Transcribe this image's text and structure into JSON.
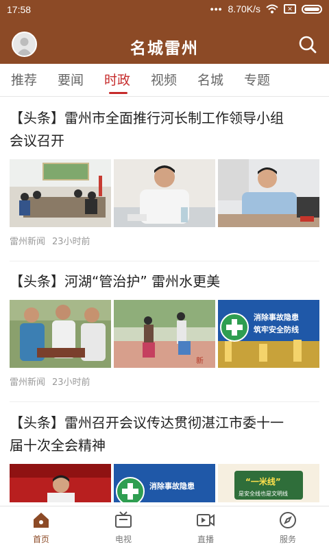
{
  "status": {
    "time": "17:58",
    "dots": "•••",
    "speed": "8.70K/s"
  },
  "app": {
    "title": "名城雷州"
  },
  "tabs": [
    "推荐",
    "要闻",
    "时政",
    "视频",
    "名城",
    "专题"
  ],
  "articles": [
    {
      "title_line1": "【头条】雷州市全面推行河长制工作领导小组",
      "title_line2": "会议召开",
      "source": "雷州新闻",
      "time": "23小时前"
    },
    {
      "title_line1": "【头条】河湖“管治护” 雷州水更美",
      "source": "雷州新闻",
      "time": "23小时前",
      "banner_line1": "消除事故隐患",
      "banner_line2": "筑牢安全防线"
    },
    {
      "title_line1": "【头条】雷州召开会议传达贯彻湛江市委十一",
      "title_line2": "届十次全会精神",
      "banner_line1": "消除事故隐患",
      "tag_big": "“一米线”",
      "tag_small": "是安全线也是文明线"
    }
  ],
  "nav": [
    {
      "label": "首页",
      "icon": "home-icon"
    },
    {
      "label": "电视",
      "icon": "tv-icon"
    },
    {
      "label": "直播",
      "icon": "live-camera-icon"
    },
    {
      "label": "服务",
      "icon": "compass-icon"
    }
  ],
  "colors": {
    "header": "#8c4a26",
    "accent": "#c62b2b"
  }
}
